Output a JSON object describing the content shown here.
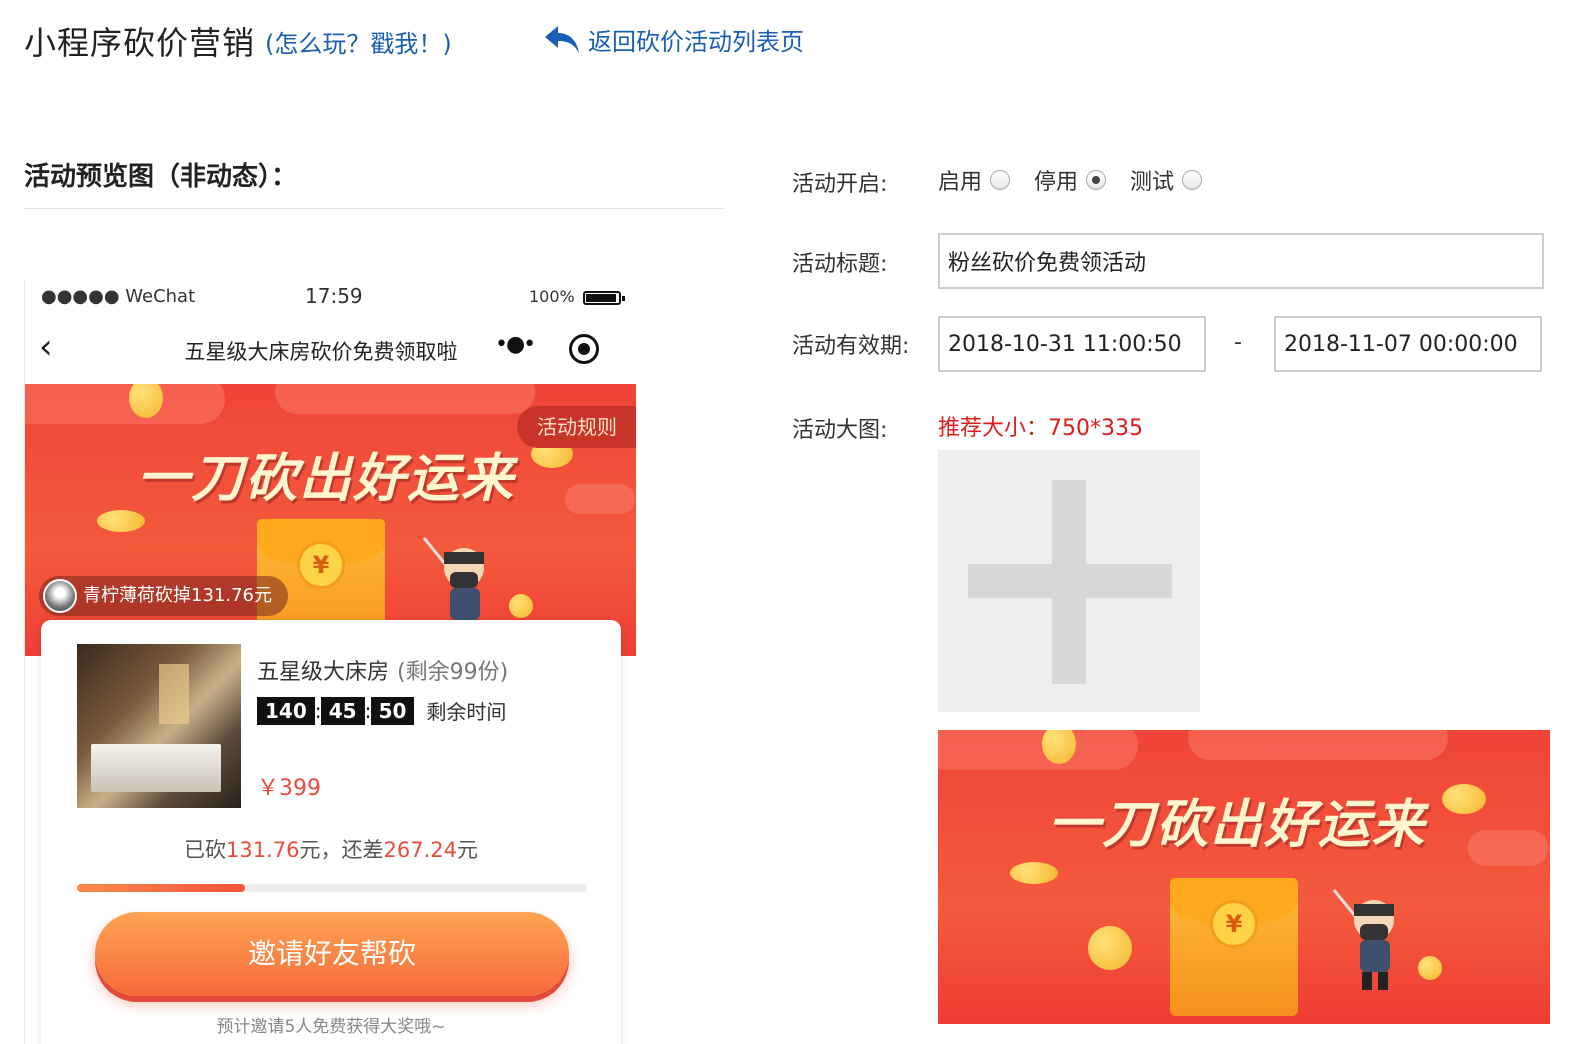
{
  "header": {
    "title": "小程序砍价营销",
    "help_link": "(怎么玩？戳我！)",
    "back_link": "返回砍价活动列表页"
  },
  "preview": {
    "section_title": "活动预览图（非动态）：",
    "status_bar": {
      "carrier": "●●●●● WeChat",
      "time": "17:59",
      "battery": "100%"
    },
    "nav": {
      "back": "‹",
      "title": "五星级大床房砍价免费领取啦",
      "more": "•●•"
    },
    "banner": {
      "rules_label": "活动规则",
      "slogan": "一刀砍出好运来",
      "yen": "¥",
      "ticker": "青柠薄荷砍掉131.76元"
    },
    "product": {
      "name": "五星级大床房",
      "stock": "(剩余99份)",
      "countdown": [
        "140",
        "45",
        "50"
      ],
      "countdown_label": "剩余时间",
      "price": "￥399",
      "cut_prefix": "已砍",
      "cut_amount": "131.76",
      "cut_middle": "元，还差",
      "remaining_amount": "267.24",
      "cut_suffix": "元",
      "progress": 0.33,
      "invite_button": "邀请好友帮砍",
      "invite_hint": "预计邀请5人免费获得大奖哦~"
    }
  },
  "form": {
    "status": {
      "label": "活动开启:",
      "options": [
        {
          "label": "启用",
          "checked": false
        },
        {
          "label": "停用",
          "checked": true
        },
        {
          "label": "测试",
          "checked": false
        }
      ]
    },
    "title": {
      "label": "活动标题:",
      "value": "粉丝砍价免费领活动"
    },
    "period": {
      "label": "活动有效期:",
      "start": "2018-10-31 11:00:50",
      "separator": "-",
      "end": "2018-11-07 00:00:00"
    },
    "image": {
      "label": "活动大图:",
      "hint": "推荐大小：750*335",
      "banner_slogan": "一刀砍出好运来",
      "banner_yen": "¥"
    }
  },
  "colors": {
    "link": "#1a5fb4",
    "accent_red": "#e94b3c",
    "hint_red": "#e01b1b",
    "banner_red": "#f04438"
  }
}
